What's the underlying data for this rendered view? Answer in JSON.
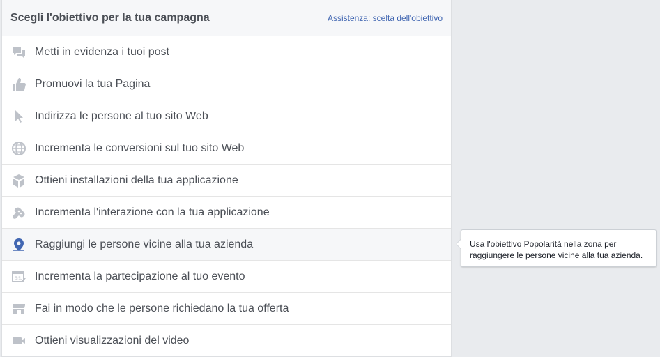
{
  "header": {
    "title": "Scegli l'obiettivo per la tua campagna",
    "help_link": "Assistenza: scelta dell'obiettivo"
  },
  "objectives": [
    {
      "label": "Metti in evidenza i tuoi post",
      "icon": "chat-bubbles-icon"
    },
    {
      "label": "Promuovi la tua Pagina",
      "icon": "thumbs-up-icon"
    },
    {
      "label": "Indirizza le persone al tuo sito Web",
      "icon": "cursor-arrow-icon"
    },
    {
      "label": "Incrementa le conversioni sul tuo sito Web",
      "icon": "globe-icon"
    },
    {
      "label": "Ottieni installazioni della tua applicazione",
      "icon": "box-icon"
    },
    {
      "label": "Incrementa l'interazione con la tua applicazione",
      "icon": "gamepad-icon"
    },
    {
      "label": "Raggiungi le persone vicine alla tua azienda",
      "icon": "map-pin-icon"
    },
    {
      "label": "Incrementa la partecipazione al tuo evento",
      "icon": "calendar-icon"
    },
    {
      "label": "Fai in modo che le persone richiedano la tua offerta",
      "icon": "storefront-icon"
    },
    {
      "label": "Ottieni visualizzazioni del video",
      "icon": "video-camera-icon"
    }
  ],
  "tooltip": {
    "text": "Usa l'obiettivo Popolarità nella zona per raggiungere le persone vicine alla tua azienda."
  },
  "colors": {
    "icon_gray": "#bec2c9",
    "icon_blue": "#4267b2",
    "text": "#4b4f56",
    "link": "#4267b2"
  }
}
